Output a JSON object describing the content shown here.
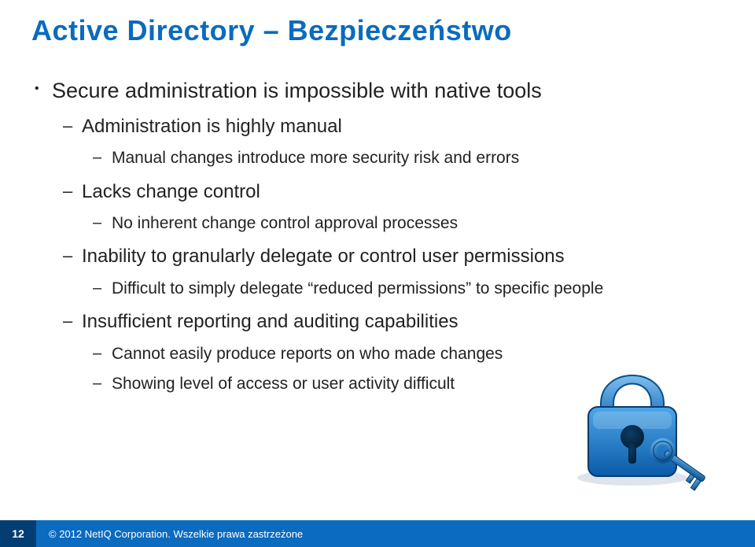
{
  "title": "Active Directory – Bezpieczeństwo",
  "bullets": {
    "l1": "Secure administration is impossible with native tools",
    "l2a": "Administration is highly manual",
    "l3a": "Manual changes introduce more security risk and errors",
    "l2b": "Lacks change control",
    "l3b": "No inherent change control approval processes",
    "l2c": "Inability to granularly delegate or control user permissions",
    "l3c": "Difficult to simply delegate “reduced permissions” to specific people",
    "l2d": "Insufficient reporting and auditing capabilities",
    "l3d": "Cannot easily produce reports on who made changes",
    "l3e": "Showing level of access or user activity difficult"
  },
  "footer": {
    "page": "12",
    "copyright": "© 2012 NetIQ Corporation. Wszelkie prawa zastrzeżone"
  }
}
